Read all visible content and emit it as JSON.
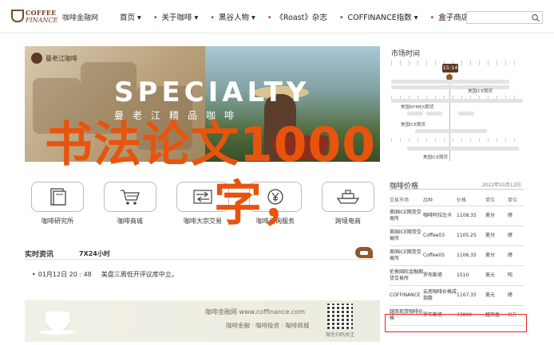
{
  "header": {
    "logo_line1": "COFFEE",
    "logo_line2": "FINANCE",
    "site_name": "咖啡金融网",
    "nav": [
      {
        "label": "首页",
        "sep": "",
        "suffix": "▾"
      },
      {
        "label": "关于咖啡",
        "sep": "•",
        "suffix": "▾"
      },
      {
        "label": "黑谷人物",
        "sep": "•",
        "suffix": "▾"
      },
      {
        "label": "《Roast》杂志",
        "sep": "•",
        "suffix": ""
      },
      {
        "label": "COFFINANCE指数",
        "sep": "•",
        "suffix": "▾"
      },
      {
        "label": "盒子商店",
        "sep": "•",
        "suffix": "▾"
      }
    ],
    "search_placeholder": ""
  },
  "banner": {
    "brand": "曼老江咖啡",
    "headline": "SPECIALTY",
    "subtitle": "曼老江精品咖啡"
  },
  "watermark": {
    "line1": "书法论文1000",
    "line2": "字，"
  },
  "categories": [
    {
      "label": "咖啡研究所",
      "icon": "book-icon"
    },
    {
      "label": "咖啡商城",
      "icon": "cart-icon"
    },
    {
      "label": "咖啡大宗交易",
      "icon": "exchange-icon"
    },
    {
      "label": "咖啡咨询服务",
      "icon": "money-icon"
    },
    {
      "label": "跨境电商",
      "icon": "ship-icon"
    }
  ],
  "realtime": {
    "title": "实时资讯",
    "subtitle": "7X24小时",
    "item": {
      "date": "01月12日 20 : 48",
      "text": "美盘三周低开评议库中立。"
    }
  },
  "ad": {
    "line1": "咖啡金融网 www.coffinance.com",
    "line2": "咖啡金融 · 咖啡投资 · 咖啡商城",
    "qr_caption": "微信扫码关注"
  },
  "market_timeline": {
    "title": "市场时间",
    "now": "15:14",
    "labels": [
      "美国ICE期货",
      "美国NYMEX期货",
      "美国ICE期货",
      "美国ICE期货"
    ]
  },
  "prices": {
    "title": "咖啡价格",
    "updated": "2022年01月12日",
    "columns": [
      "交易市场",
      "品种",
      "价格",
      "单位",
      "单位"
    ],
    "rows": [
      [
        "美国ICE期货交易所",
        "咖啡阿拉比卡",
        "1108.35",
        "美分",
        "磅"
      ],
      [
        "美国ICE期货交易所",
        "Coffee03",
        "1105.25",
        "美分",
        "磅"
      ],
      [
        "美国ICE期货交易所",
        "Coffee05",
        "1106.35",
        "美分",
        "磅"
      ],
      [
        "伦敦国际金融期货交易所",
        "罗布斯塔",
        "1510",
        "美元",
        "吨"
      ],
      [
        "COFFINANCE",
        "云南咖啡价格成指数",
        "1107.35",
        "美元",
        "磅"
      ],
      [
        "越南现货咖啡价格",
        "罗布斯塔",
        "33800",
        "越南盾",
        "公斤"
      ]
    ]
  },
  "colors": {
    "accent": "#8b5a2b",
    "watermark": "#e8540e",
    "highlight": "#ee2222"
  }
}
